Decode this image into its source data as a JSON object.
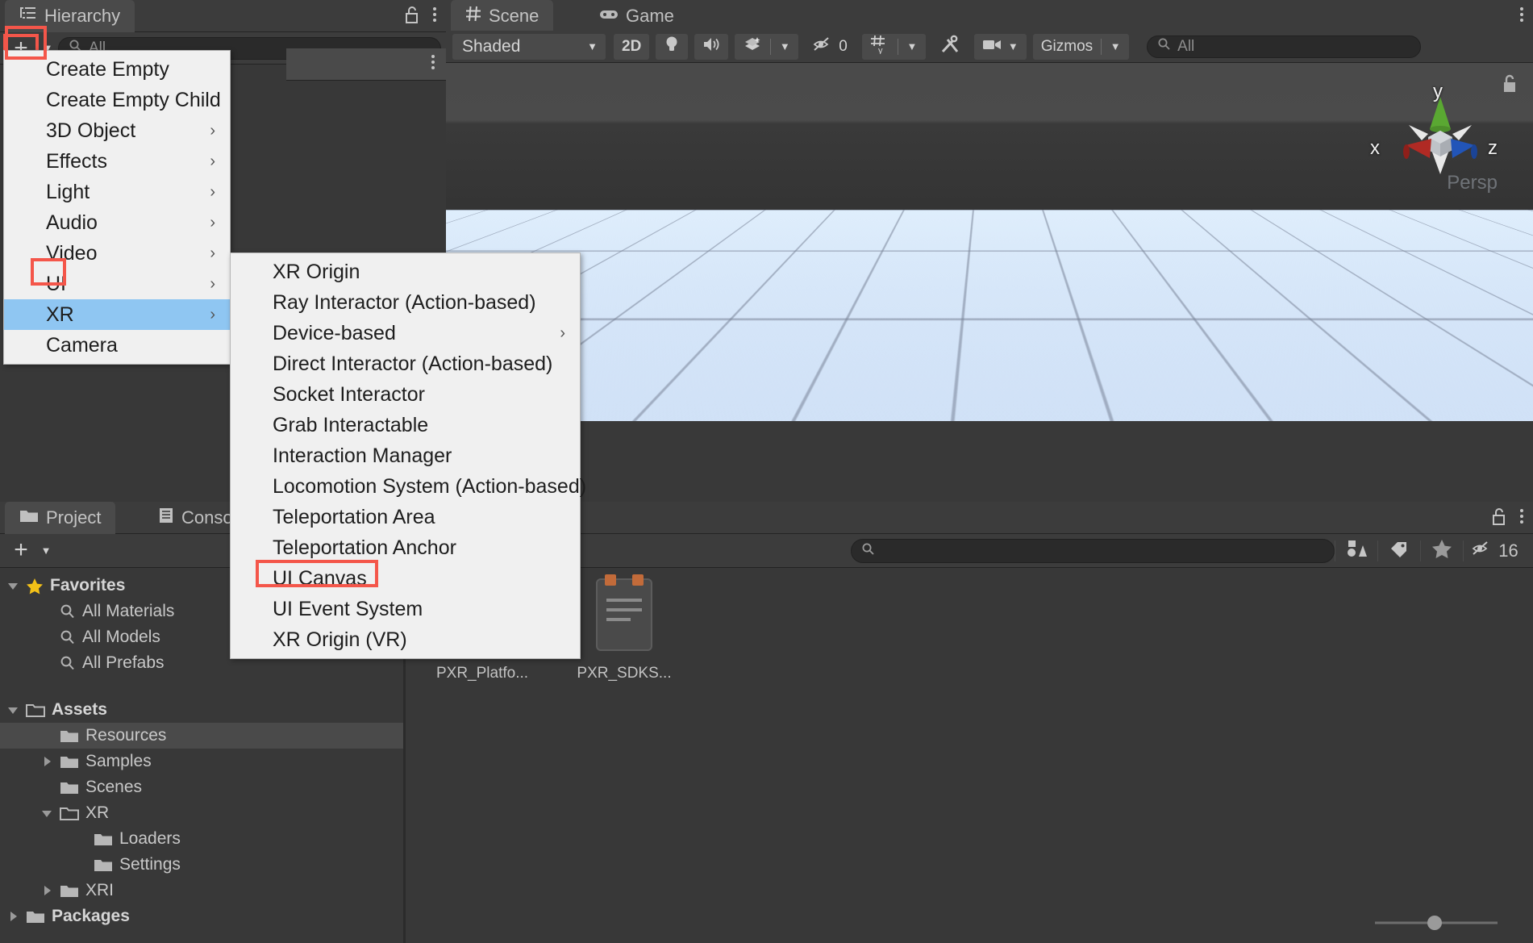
{
  "hierarchy": {
    "tab_label": "Hierarchy",
    "tab_icon": "hierarchy-list-icon",
    "add_button_label": "+",
    "search_placeholder": "All",
    "lock_icon": "unlocked-padlock-icon",
    "menu_icon": "kebab-menu-icon"
  },
  "create_menu": {
    "items": [
      {
        "label": "Create Empty",
        "submenu": false,
        "selected": false
      },
      {
        "label": "Create Empty Child",
        "submenu": false,
        "selected": false
      },
      {
        "label": "3D Object",
        "submenu": true,
        "selected": false
      },
      {
        "label": "Effects",
        "submenu": true,
        "selected": false
      },
      {
        "label": "Light",
        "submenu": true,
        "selected": false
      },
      {
        "label": "Audio",
        "submenu": true,
        "selected": false
      },
      {
        "label": "Video",
        "submenu": true,
        "selected": false
      },
      {
        "label": "UI",
        "submenu": true,
        "selected": false
      },
      {
        "label": "XR",
        "submenu": true,
        "selected": true
      },
      {
        "label": "Camera",
        "submenu": false,
        "selected": false
      }
    ]
  },
  "xr_submenu": {
    "items": [
      {
        "label": "XR Origin",
        "submenu": false
      },
      {
        "label": "Ray Interactor (Action-based)",
        "submenu": false
      },
      {
        "label": "Device-based",
        "submenu": true
      },
      {
        "label": "Direct Interactor (Action-based)",
        "submenu": false
      },
      {
        "label": "Socket Interactor",
        "submenu": false
      },
      {
        "label": "Grab Interactable",
        "submenu": false
      },
      {
        "label": "Interaction Manager",
        "submenu": false
      },
      {
        "label": "Locomotion System (Action-based)",
        "submenu": false
      },
      {
        "label": "Teleportation Area",
        "submenu": false
      },
      {
        "label": "Teleportation Anchor",
        "submenu": false
      },
      {
        "label": "UI Canvas",
        "submenu": false
      },
      {
        "label": "UI Event System",
        "submenu": false
      },
      {
        "label": "XR Origin (VR)",
        "submenu": false
      }
    ]
  },
  "scene": {
    "tabs": [
      {
        "label": "Scene",
        "icon": "grid-hash-icon",
        "active": true
      },
      {
        "label": "Game",
        "icon": "gamepad-icon",
        "active": false
      }
    ],
    "toolbar": {
      "draw_mode": "Shaded",
      "two_d_label": "2D",
      "lighting_icon": "lightbulb-icon",
      "audio_icon": "speaker-icon",
      "fx_icon": "effects-layers-icon",
      "hidden_objects_count": "0",
      "hidden_icon": "eye-slash-icon",
      "grid_icon": "grid-axis-y-icon",
      "tools_icon": "wrench-screwdriver-icon",
      "camera_icon": "video-camera-icon",
      "gizmos_label": "Gizmos",
      "search_placeholder": "All"
    },
    "gizmo": {
      "axis_x": "x",
      "axis_y": "y",
      "axis_z": "z",
      "projection_label": "Persp",
      "color_x": "#b02a24",
      "color_y": "#5aa832",
      "color_z": "#2255b8",
      "lock_icon": "unlocked-padlock-icon"
    }
  },
  "project": {
    "tabs": [
      {
        "label": "Project",
        "icon": "folder-icon",
        "active": true
      },
      {
        "label": "Console",
        "icon": "console-lines-icon",
        "active": false
      }
    ],
    "add_button_label": "+",
    "search_placeholder": "",
    "lock_icon": "unlocked-padlock-icon",
    "menu_icon": "kebab-menu-icon",
    "right_tools": [
      {
        "icon": "shapes-filter-icon",
        "label": ""
      },
      {
        "icon": "tag-label-icon",
        "label": ""
      },
      {
        "icon": "star-favorite-icon",
        "label": ""
      },
      {
        "icon": "eye-slash-icon",
        "label": "16"
      }
    ],
    "tree": [
      {
        "label": "Favorites",
        "depth": 0,
        "expanded": true,
        "icon": "star-icon",
        "bold": true,
        "selected": false,
        "arrow": "down"
      },
      {
        "label": "All Materials",
        "depth": 1,
        "icon": "search-icon",
        "bold": false,
        "selected": false,
        "arrow": "none"
      },
      {
        "label": "All Models",
        "depth": 1,
        "icon": "search-icon",
        "bold": false,
        "selected": false,
        "arrow": "none"
      },
      {
        "label": "All Prefabs",
        "depth": 1,
        "icon": "search-icon",
        "bold": false,
        "selected": false,
        "arrow": "none"
      },
      {
        "label": "",
        "depth": 0,
        "icon": "spacer",
        "bold": false,
        "selected": false,
        "arrow": "none"
      },
      {
        "label": "Assets",
        "depth": 0,
        "expanded": true,
        "icon": "folder-open-icon",
        "bold": true,
        "selected": false,
        "arrow": "down"
      },
      {
        "label": "Resources",
        "depth": 1,
        "icon": "folder-icon",
        "bold": false,
        "selected": true,
        "arrow": "none"
      },
      {
        "label": "Samples",
        "depth": 1,
        "icon": "folder-icon",
        "bold": false,
        "selected": false,
        "arrow": "right"
      },
      {
        "label": "Scenes",
        "depth": 1,
        "icon": "folder-icon",
        "bold": false,
        "selected": false,
        "arrow": "none"
      },
      {
        "label": "XR",
        "depth": 1,
        "icon": "folder-open-icon",
        "bold": false,
        "selected": false,
        "arrow": "down"
      },
      {
        "label": "Loaders",
        "depth": 2,
        "icon": "folder-icon",
        "bold": false,
        "selected": false,
        "arrow": "none"
      },
      {
        "label": "Settings",
        "depth": 2,
        "icon": "folder-icon",
        "bold": false,
        "selected": false,
        "arrow": "none"
      },
      {
        "label": "XRI",
        "depth": 1,
        "icon": "folder-icon",
        "bold": false,
        "selected": false,
        "arrow": "right"
      },
      {
        "label": "Packages",
        "depth": 0,
        "icon": "folder-icon",
        "bold": true,
        "selected": false,
        "arrow": "right"
      }
    ],
    "assets": [
      {
        "label": "PXR_Platfo...",
        "icon": "script-asset-icon"
      },
      {
        "label": "PXR_SDKS...",
        "icon": "script-asset-icon"
      }
    ],
    "zoom_slider_value": 50
  },
  "colors": {
    "panel_bg": "#383838",
    "toolbar_bg": "#3c3c3c",
    "tab_active": "#4a4a4a",
    "menu_bg": "#f0f0f0",
    "menu_highlight": "#8fc6f2",
    "annotation_red": "#f4564a",
    "accent_blue": "#2c5d87",
    "ground_light": "#cfe0f6"
  }
}
